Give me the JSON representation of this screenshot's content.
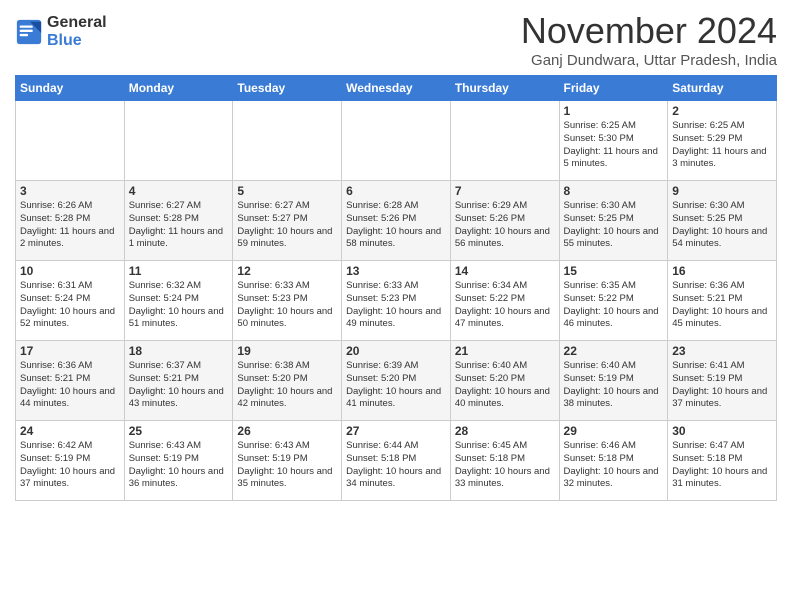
{
  "header": {
    "logo_general": "General",
    "logo_blue": "Blue",
    "title": "November 2024",
    "location": "Ganj Dundwara, Uttar Pradesh, India"
  },
  "days_of_week": [
    "Sunday",
    "Monday",
    "Tuesday",
    "Wednesday",
    "Thursday",
    "Friday",
    "Saturday"
  ],
  "weeks": [
    [
      {
        "day": "",
        "info": ""
      },
      {
        "day": "",
        "info": ""
      },
      {
        "day": "",
        "info": ""
      },
      {
        "day": "",
        "info": ""
      },
      {
        "day": "",
        "info": ""
      },
      {
        "day": "1",
        "info": "Sunrise: 6:25 AM\nSunset: 5:30 PM\nDaylight: 11 hours and 5 minutes."
      },
      {
        "day": "2",
        "info": "Sunrise: 6:25 AM\nSunset: 5:29 PM\nDaylight: 11 hours and 3 minutes."
      }
    ],
    [
      {
        "day": "3",
        "info": "Sunrise: 6:26 AM\nSunset: 5:28 PM\nDaylight: 11 hours and 2 minutes."
      },
      {
        "day": "4",
        "info": "Sunrise: 6:27 AM\nSunset: 5:28 PM\nDaylight: 11 hours and 1 minute."
      },
      {
        "day": "5",
        "info": "Sunrise: 6:27 AM\nSunset: 5:27 PM\nDaylight: 10 hours and 59 minutes."
      },
      {
        "day": "6",
        "info": "Sunrise: 6:28 AM\nSunset: 5:26 PM\nDaylight: 10 hours and 58 minutes."
      },
      {
        "day": "7",
        "info": "Sunrise: 6:29 AM\nSunset: 5:26 PM\nDaylight: 10 hours and 56 minutes."
      },
      {
        "day": "8",
        "info": "Sunrise: 6:30 AM\nSunset: 5:25 PM\nDaylight: 10 hours and 55 minutes."
      },
      {
        "day": "9",
        "info": "Sunrise: 6:30 AM\nSunset: 5:25 PM\nDaylight: 10 hours and 54 minutes."
      }
    ],
    [
      {
        "day": "10",
        "info": "Sunrise: 6:31 AM\nSunset: 5:24 PM\nDaylight: 10 hours and 52 minutes."
      },
      {
        "day": "11",
        "info": "Sunrise: 6:32 AM\nSunset: 5:24 PM\nDaylight: 10 hours and 51 minutes."
      },
      {
        "day": "12",
        "info": "Sunrise: 6:33 AM\nSunset: 5:23 PM\nDaylight: 10 hours and 50 minutes."
      },
      {
        "day": "13",
        "info": "Sunrise: 6:33 AM\nSunset: 5:23 PM\nDaylight: 10 hours and 49 minutes."
      },
      {
        "day": "14",
        "info": "Sunrise: 6:34 AM\nSunset: 5:22 PM\nDaylight: 10 hours and 47 minutes."
      },
      {
        "day": "15",
        "info": "Sunrise: 6:35 AM\nSunset: 5:22 PM\nDaylight: 10 hours and 46 minutes."
      },
      {
        "day": "16",
        "info": "Sunrise: 6:36 AM\nSunset: 5:21 PM\nDaylight: 10 hours and 45 minutes."
      }
    ],
    [
      {
        "day": "17",
        "info": "Sunrise: 6:36 AM\nSunset: 5:21 PM\nDaylight: 10 hours and 44 minutes."
      },
      {
        "day": "18",
        "info": "Sunrise: 6:37 AM\nSunset: 5:21 PM\nDaylight: 10 hours and 43 minutes."
      },
      {
        "day": "19",
        "info": "Sunrise: 6:38 AM\nSunset: 5:20 PM\nDaylight: 10 hours and 42 minutes."
      },
      {
        "day": "20",
        "info": "Sunrise: 6:39 AM\nSunset: 5:20 PM\nDaylight: 10 hours and 41 minutes."
      },
      {
        "day": "21",
        "info": "Sunrise: 6:40 AM\nSunset: 5:20 PM\nDaylight: 10 hours and 40 minutes."
      },
      {
        "day": "22",
        "info": "Sunrise: 6:40 AM\nSunset: 5:19 PM\nDaylight: 10 hours and 38 minutes."
      },
      {
        "day": "23",
        "info": "Sunrise: 6:41 AM\nSunset: 5:19 PM\nDaylight: 10 hours and 37 minutes."
      }
    ],
    [
      {
        "day": "24",
        "info": "Sunrise: 6:42 AM\nSunset: 5:19 PM\nDaylight: 10 hours and 37 minutes."
      },
      {
        "day": "25",
        "info": "Sunrise: 6:43 AM\nSunset: 5:19 PM\nDaylight: 10 hours and 36 minutes."
      },
      {
        "day": "26",
        "info": "Sunrise: 6:43 AM\nSunset: 5:19 PM\nDaylight: 10 hours and 35 minutes."
      },
      {
        "day": "27",
        "info": "Sunrise: 6:44 AM\nSunset: 5:18 PM\nDaylight: 10 hours and 34 minutes."
      },
      {
        "day": "28",
        "info": "Sunrise: 6:45 AM\nSunset: 5:18 PM\nDaylight: 10 hours and 33 minutes."
      },
      {
        "day": "29",
        "info": "Sunrise: 6:46 AM\nSunset: 5:18 PM\nDaylight: 10 hours and 32 minutes."
      },
      {
        "day": "30",
        "info": "Sunrise: 6:47 AM\nSunset: 5:18 PM\nDaylight: 10 hours and 31 minutes."
      }
    ]
  ]
}
